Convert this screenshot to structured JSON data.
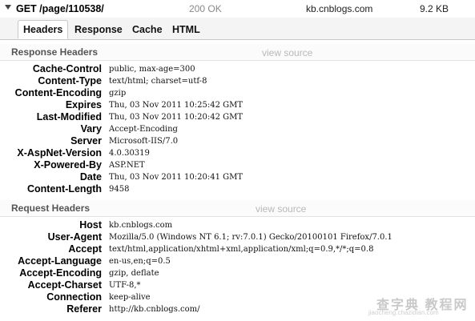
{
  "request": {
    "method_path": "GET /page/110538/",
    "status": "200 OK",
    "domain": "kb.cnblogs.com",
    "size": "9.2 KB"
  },
  "tabs": [
    {
      "label": "Headers",
      "selected": true
    },
    {
      "label": "Response",
      "selected": false
    },
    {
      "label": "Cache",
      "selected": false
    },
    {
      "label": "HTML",
      "selected": false
    }
  ],
  "response_headers": {
    "title": "Response Headers",
    "view_source": "view source",
    "rows": [
      {
        "name": "Cache-Control",
        "value": "public, max-age=300"
      },
      {
        "name": "Content-Type",
        "value": "text/html; charset=utf-8"
      },
      {
        "name": "Content-Encoding",
        "value": "gzip"
      },
      {
        "name": "Expires",
        "value": "Thu, 03 Nov 2011 10:25:42 GMT"
      },
      {
        "name": "Last-Modified",
        "value": "Thu, 03 Nov 2011 10:20:42 GMT"
      },
      {
        "name": "Vary",
        "value": "Accept-Encoding"
      },
      {
        "name": "Server",
        "value": "Microsoft-IIS/7.0"
      },
      {
        "name": "X-AspNet-Version",
        "value": "4.0.30319"
      },
      {
        "name": "X-Powered-By",
        "value": "ASP.NET"
      },
      {
        "name": "Date",
        "value": "Thu, 03 Nov 2011 10:20:41 GMT"
      },
      {
        "name": "Content-Length",
        "value": "9458"
      }
    ]
  },
  "request_headers": {
    "title": "Request Headers",
    "view_source": "view source",
    "rows": [
      {
        "name": "Host",
        "value": "kb.cnblogs.com"
      },
      {
        "name": "User-Agent",
        "value": "Mozilla/5.0 (Windows NT 6.1; rv:7.0.1) Gecko/20100101 Firefox/7.0.1"
      },
      {
        "name": "Accept",
        "value": "text/html,application/xhtml+xml,application/xml;q=0.9,*/*;q=0.8"
      },
      {
        "name": "Accept-Language",
        "value": "en-us,en;q=0.5"
      },
      {
        "name": "Accept-Encoding",
        "value": "gzip, deflate"
      },
      {
        "name": "Accept-Charset",
        "value": "UTF-8,*"
      },
      {
        "name": "Connection",
        "value": "keep-alive"
      },
      {
        "name": "Referer",
        "value": "http://kb.cnblogs.com/"
      }
    ]
  },
  "watermark": {
    "main": "查字典 教程网",
    "sub": "jiaocheng.chazidian.com"
  }
}
